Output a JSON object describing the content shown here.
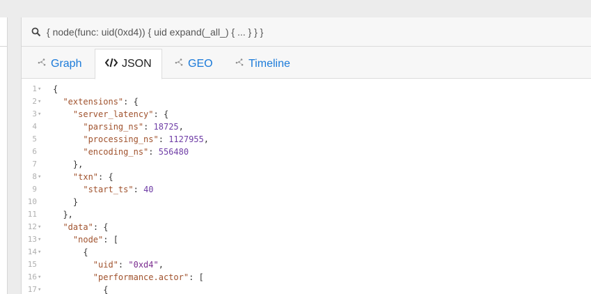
{
  "query": {
    "text": "{ node(func: uid(0xd4)) { uid expand(_all_) { ... } } }"
  },
  "tabs": [
    {
      "label": "Graph",
      "icon": "graph-icon",
      "active": false
    },
    {
      "label": "JSON",
      "icon": "code-icon",
      "active": true
    },
    {
      "label": "GEO",
      "icon": "geo-icon",
      "active": false
    },
    {
      "label": "Timeline",
      "icon": "timeline-icon",
      "active": false
    }
  ],
  "editor": {
    "lines": [
      {
        "n": "1",
        "fold": true,
        "text": "{"
      },
      {
        "n": "2",
        "fold": true,
        "text": "  \"extensions\": {"
      },
      {
        "n": "3",
        "fold": true,
        "text": "    \"server_latency\": {"
      },
      {
        "n": "4",
        "fold": false,
        "text": "      \"parsing_ns\": 18725,"
      },
      {
        "n": "5",
        "fold": false,
        "text": "      \"processing_ns\": 1127955,"
      },
      {
        "n": "6",
        "fold": false,
        "text": "      \"encoding_ns\": 556480"
      },
      {
        "n": "7",
        "fold": false,
        "text": "    },"
      },
      {
        "n": "8",
        "fold": true,
        "text": "    \"txn\": {"
      },
      {
        "n": "9",
        "fold": false,
        "text": "      \"start_ts\": 40"
      },
      {
        "n": "10",
        "fold": false,
        "text": "    }"
      },
      {
        "n": "11",
        "fold": false,
        "text": "  },"
      },
      {
        "n": "12",
        "fold": true,
        "text": "  \"data\": {"
      },
      {
        "n": "13",
        "fold": true,
        "text": "    \"node\": ["
      },
      {
        "n": "14",
        "fold": true,
        "text": "      {"
      },
      {
        "n": "15",
        "fold": false,
        "text": "        \"uid\": \"0xd4\","
      },
      {
        "n": "16",
        "fold": true,
        "text": "        \"performance.actor\": ["
      },
      {
        "n": "17",
        "fold": true,
        "text": "          {"
      }
    ]
  },
  "colors": {
    "link": "#1a7ad9",
    "json_key": "#a0522d",
    "json_string": "#7a2c8f",
    "json_number": "#6f3da6"
  }
}
